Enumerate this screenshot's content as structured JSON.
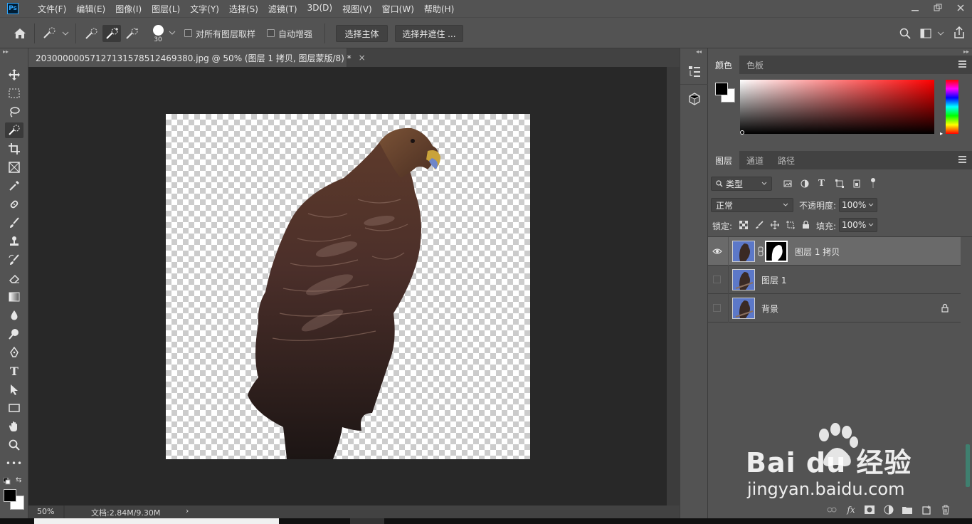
{
  "app": {
    "logo": "Ps"
  },
  "menu": [
    "文件(F)",
    "编辑(E)",
    "图像(I)",
    "图层(L)",
    "文字(Y)",
    "选择(S)",
    "滤镜(T)",
    "3D(D)",
    "视图(V)",
    "窗口(W)",
    "帮助(H)"
  ],
  "options": {
    "brush_size": "30",
    "sample_all_layers": "对所有图层取样",
    "auto_enhance": "自动增强",
    "select_subject": "选择主体",
    "select_and_mask": "选择并遮住 ..."
  },
  "document": {
    "tab_title": "20300000057127131578512469380.jpg @ 50% (图层 1 拷贝, 图层蒙版/8) *",
    "close": "×"
  },
  "status": {
    "zoom": "50%",
    "doc_info": "文档:2.84M/9.30M",
    "arrow": "›"
  },
  "color_panel": {
    "tabs": [
      "颜色",
      "色板"
    ],
    "active_tab": 0
  },
  "layers_panel": {
    "tabs": [
      "图层",
      "通道",
      "路径"
    ],
    "active_tab": 0,
    "filter_kind": "类型",
    "blend_mode": "正常",
    "opacity_label": "不透明度:",
    "opacity": "100%",
    "lock_label": "锁定:",
    "fill_label": "填充:",
    "fill": "100%",
    "layers": [
      {
        "name": "图层 1 拷贝",
        "visible": true,
        "selected": true,
        "mask": true
      },
      {
        "name": "图层 1",
        "visible": false,
        "selected": false,
        "mask": false
      },
      {
        "name": "背景",
        "visible": false,
        "selected": false,
        "mask": false,
        "locked": true
      }
    ]
  },
  "watermark": {
    "brand": "Bai du 经验",
    "url": "jingyan.baidu.com"
  },
  "colors": {
    "panel": "#535353",
    "dark": "#424242",
    "canvas_bg": "#282828",
    "selected_layer": "#6a6a6a"
  }
}
